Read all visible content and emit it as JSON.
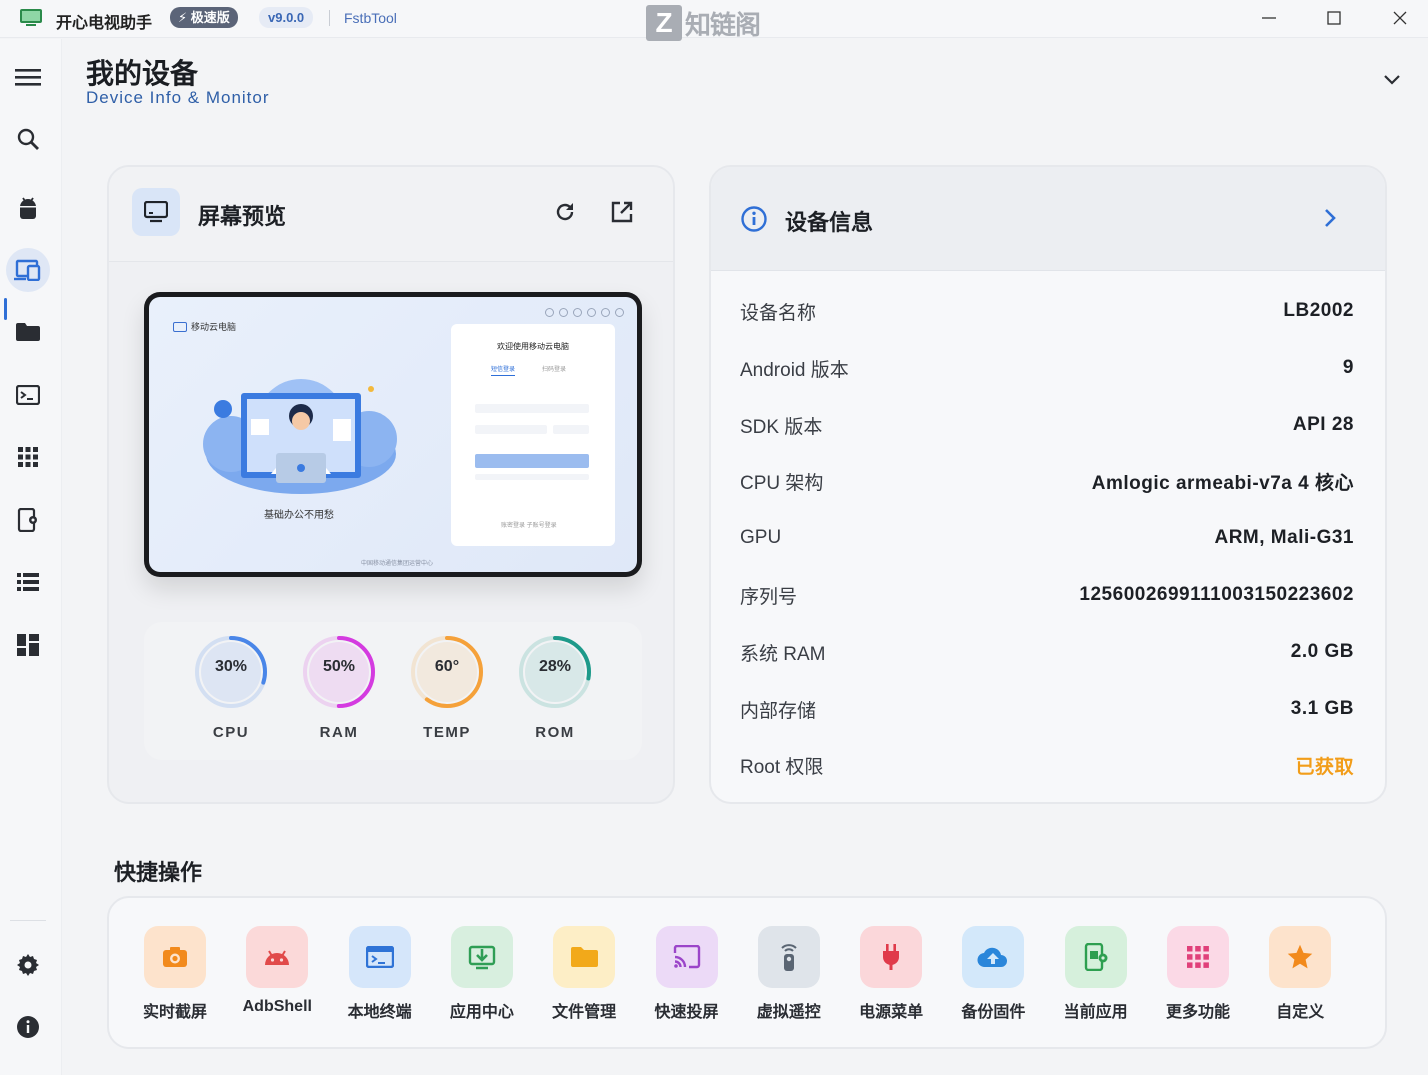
{
  "titlebar": {
    "app_name": "开心电视助手",
    "speed_badge": "⚡ 极速版",
    "version": "v9.0.0",
    "tool": "FstbTool",
    "watermark_letter": "Z",
    "watermark_text": "知链阁"
  },
  "header": {
    "title": "我的设备",
    "subtitle": "Device Info & Monitor"
  },
  "preview": {
    "title": "屏幕预览",
    "screen": {
      "brand": "移动云电脑",
      "caption": "基础办公不用愁",
      "footer": "中国移动通信集团运营中心",
      "panel_title": "欢迎使用移动云电脑",
      "tab_active": "短信登录",
      "tab_other": "扫码登录",
      "links": "账密登录    子账号登录"
    },
    "gauges": [
      {
        "label": "CPU",
        "value": "30%",
        "level": 0.3,
        "color": "#4a86e8"
      },
      {
        "label": "RAM",
        "value": "50%",
        "level": 0.5,
        "color": "#d43be0"
      },
      {
        "label": "TEMP",
        "value": "60°",
        "level": 0.6,
        "color": "#f5a13a"
      },
      {
        "label": "ROM",
        "value": "28%",
        "level": 0.28,
        "color": "#1e9a8a"
      }
    ]
  },
  "info": {
    "title": "设备信息",
    "rows": [
      {
        "label": "设备名称",
        "value": "LB2002"
      },
      {
        "label": "Android 版本",
        "value": "9"
      },
      {
        "label": "SDK 版本",
        "value": "API 28"
      },
      {
        "label": "CPU 架构",
        "value": "Amlogic armeabi-v7a 4 核心"
      },
      {
        "label": "GPU",
        "value": "ARM, Mali-G31"
      },
      {
        "label": "序列号",
        "value": "125600269911100315022360​2"
      },
      {
        "label": "系统 RAM",
        "value": "2.0 GB"
      },
      {
        "label": "内部存储",
        "value": "3.1 GB"
      },
      {
        "label": "Root 权限",
        "value": "已获取",
        "status_color": "#f29d19"
      }
    ]
  },
  "quick": {
    "title": "快捷操作",
    "items": [
      {
        "label": "实时截屏",
        "icon": "camera-icon",
        "bg": "#fde3cc",
        "fg": "#f28a1c"
      },
      {
        "label": "AdbShell",
        "icon": "android-icon",
        "bg": "#fbd9d9",
        "fg": "#e14a4a"
      },
      {
        "label": "本地终端",
        "icon": "terminal-icon",
        "bg": "#d5e6fa",
        "fg": "#2f73d6"
      },
      {
        "label": "应用中心",
        "icon": "app-download-icon",
        "bg": "#d8efdf",
        "fg": "#2f9e55"
      },
      {
        "label": "文件管理",
        "icon": "folder-icon",
        "bg": "#fdeec6",
        "fg": "#f2a91a"
      },
      {
        "label": "快速投屏",
        "icon": "cast-icon",
        "bg": "#ecdaf7",
        "fg": "#9b45c9"
      },
      {
        "label": "虚拟遥控",
        "icon": "remote-icon",
        "bg": "#dfe4ea",
        "fg": "#5a6573"
      },
      {
        "label": "电源菜单",
        "icon": "power-plug-icon",
        "bg": "#fbd7da",
        "fg": "#e03a4a"
      },
      {
        "label": "备份固件",
        "icon": "cloud-upload-icon",
        "bg": "#d3e8fa",
        "fg": "#2a86da"
      },
      {
        "label": "当前应用",
        "icon": "current-app-icon",
        "bg": "#d6f0dc",
        "fg": "#2e9f50"
      },
      {
        "label": "更多功能",
        "icon": "grid-apps-icon",
        "bg": "#fbd9e6",
        "fg": "#e0407a"
      },
      {
        "label": "自定义",
        "icon": "star-icon",
        "bg": "#fde3cc",
        "fg": "#f28a1c"
      }
    ]
  },
  "colors": {
    "accent": "#2f6fd6",
    "root_ok": "#f29d19"
  }
}
